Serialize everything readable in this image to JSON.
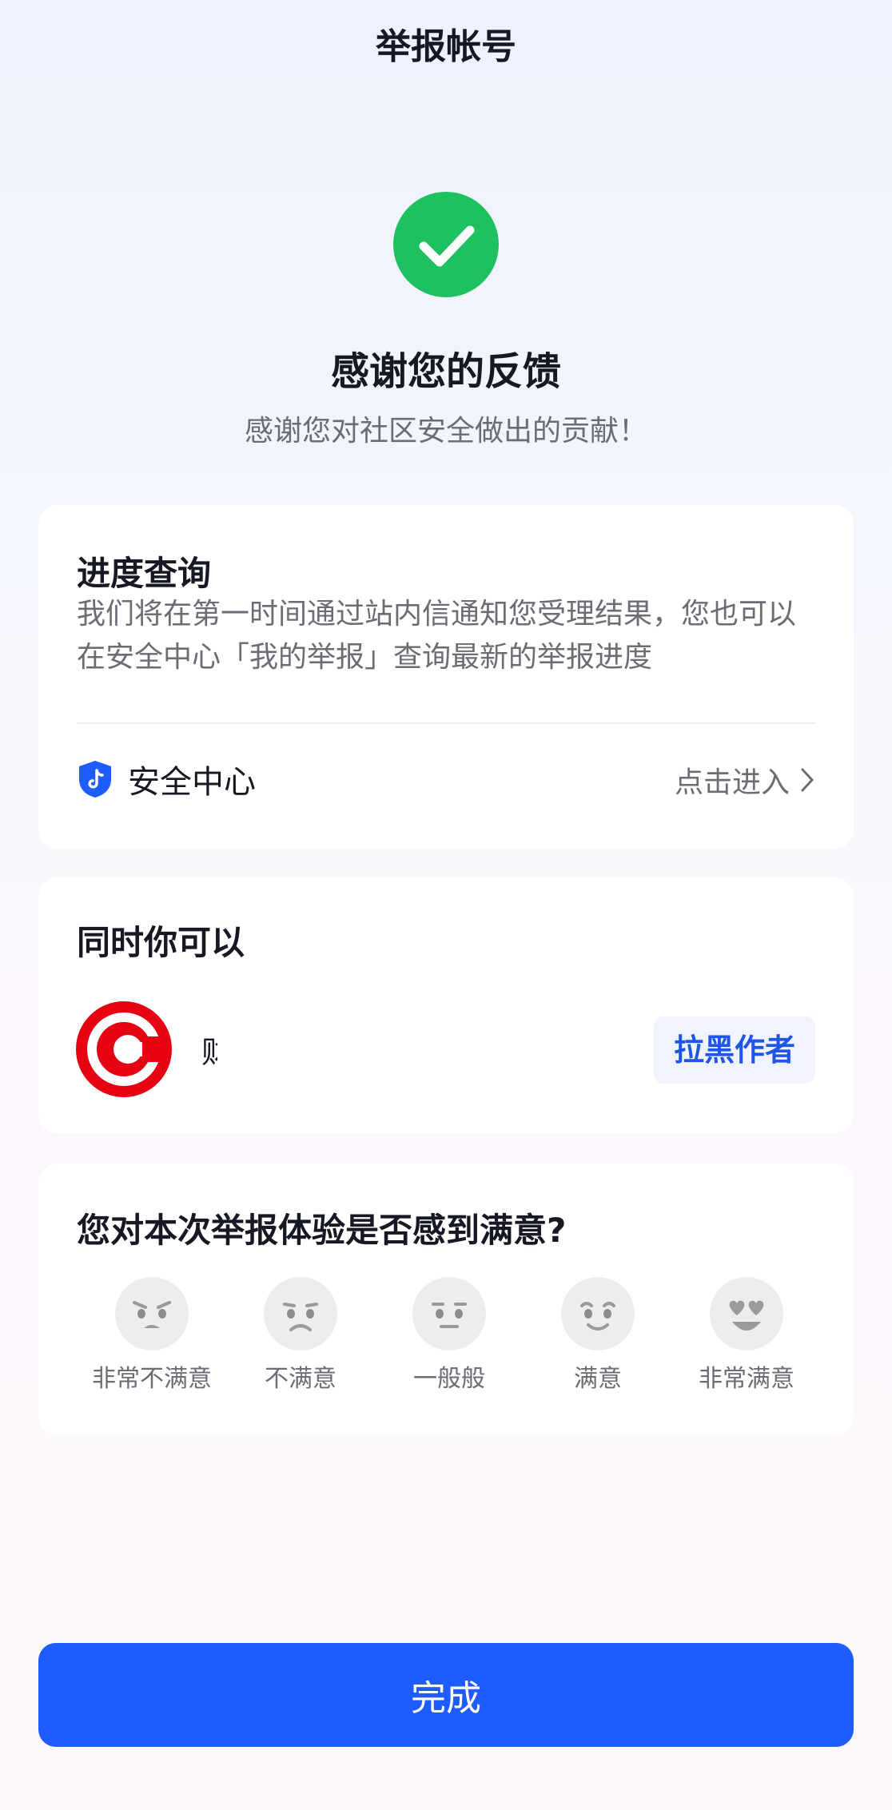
{
  "header": {
    "title": "举报帐号"
  },
  "result": {
    "title": "感谢您的反馈",
    "subtitle": "感谢您对社区安全做出的贡献！"
  },
  "progress_card": {
    "title": "进度查询",
    "description": "我们将在第一时间通过站内信通知您受理结果，您也可以在安全中心「我的举报」查询最新的举报进度",
    "safety_center_label": "安全中心",
    "enter_label": "点击进入"
  },
  "also_card": {
    "title": "同时你可以",
    "author_name": "财…社",
    "block_button_label": "拉黑作者"
  },
  "rating_card": {
    "question": "您对本次举报体验是否感到满意?",
    "options": [
      "非常不满意",
      "不满意",
      "一般般",
      "满意",
      "非常满意"
    ]
  },
  "footer": {
    "done_label": "完成"
  },
  "colors": {
    "accent": "#1f5cff",
    "success": "#1ec15f",
    "avatar_red": "#e60012",
    "shield_blue": "#1f5cff"
  },
  "icons": [
    "success-check-icon",
    "shield-icon",
    "chevron-right-icon",
    "author-avatar",
    "face-icon"
  ]
}
